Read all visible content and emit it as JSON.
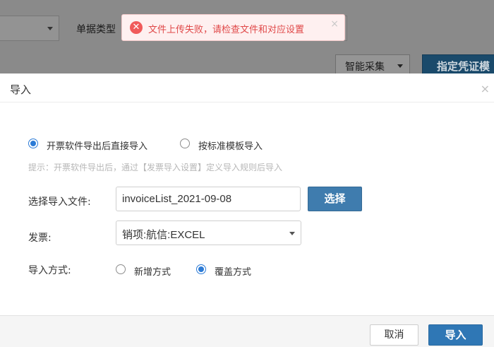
{
  "background": {
    "doc_type_label": "单据类型",
    "smart_collect_label": "智能采集",
    "assign_voucher_label": "指定凭证模"
  },
  "toast": {
    "message": "文件上传失败，请检查文件和对应设置",
    "error_icon": "✕",
    "close_icon": "×"
  },
  "dialog": {
    "title": "导入",
    "close_icon": "×",
    "import_source": {
      "options": [
        "开票软件导出后直接导入",
        "按标准模板导入"
      ],
      "selected": "开票软件导出后直接导入"
    },
    "hint": "提示：开票软件导出后，通过【发票导入设置】定义导入规则后导入",
    "file": {
      "label": "选择导入文件:",
      "value": "invoiceList_2021-09-08",
      "choose_button": "选择"
    },
    "invoice": {
      "label": "发票:",
      "selected": "销项:航信:EXCEL"
    },
    "import_mode": {
      "label": "导入方式:",
      "options": [
        "新增方式",
        "覆盖方式"
      ],
      "selected": "覆盖方式"
    },
    "footer": {
      "cancel_label": "取消",
      "import_label": "导入"
    }
  },
  "colors": {
    "primary": "#2f77b5",
    "radio_checked": "#2c7bd6",
    "toast_text": "#e04848",
    "toast_bg": "#fef0f0"
  }
}
